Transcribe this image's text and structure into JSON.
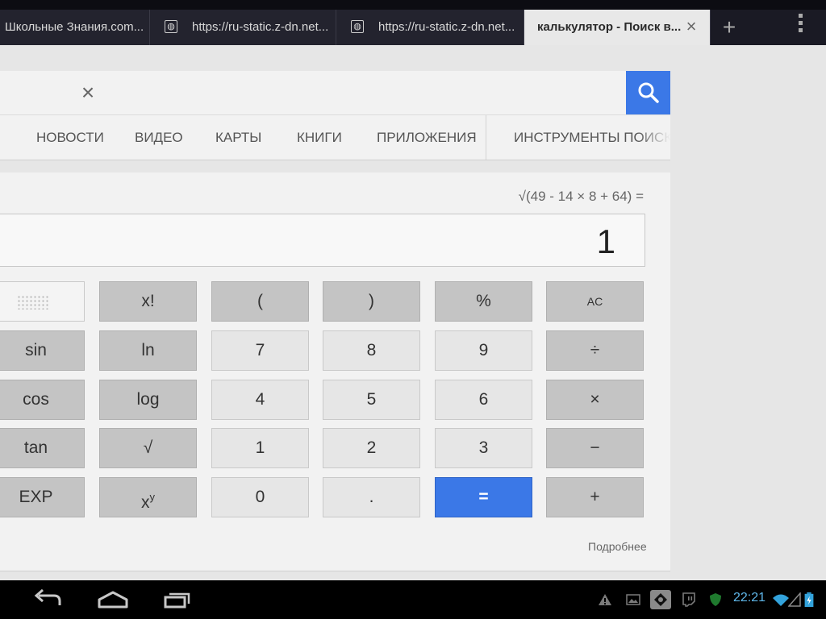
{
  "tabs": [
    {
      "label": "Школьные Знания.com..."
    },
    {
      "label": "https://ru-static.z-dn.net..."
    },
    {
      "label": "https://ru-static.z-dn.net..."
    },
    {
      "label": "калькулятор - Поиск в..."
    }
  ],
  "tab_icons": {
    "close": "×",
    "new_tab": "+"
  },
  "search": {
    "clear_icon": "×"
  },
  "nav": {
    "items": [
      "НОВОСТИ",
      "ВИДЕО",
      "КАРТЫ",
      "КНИГИ",
      "ПРИЛОЖЕНИЯ"
    ],
    "tools": "ИНСТРУМЕНТЫ ПОИСКА"
  },
  "calculator": {
    "expression": "√(49 - 14 × 8 + 64) =",
    "display": "1",
    "buttons": {
      "fact": "x!",
      "lparen": "(",
      "rparen": ")",
      "percent": "%",
      "ac": "AC",
      "sin": "sin",
      "ln": "ln",
      "n7": "7",
      "n8": "8",
      "n9": "9",
      "div": "÷",
      "cos": "cos",
      "log": "log",
      "n4": "4",
      "n5": "5",
      "n6": "6",
      "mul": "×",
      "tan": "tan",
      "sqrt": "√",
      "n1": "1",
      "n2": "2",
      "n3": "3",
      "sub": "−",
      "exp": "EXP",
      "pow_base": "x",
      "pow_sup": "y",
      "n0": "0",
      "dot": ".",
      "eq": "=",
      "add": "+"
    },
    "more": "Подробнее"
  },
  "statusbar": {
    "time": "22:21"
  },
  "colors": {
    "accent": "#3b78e7",
    "clock": "#5fb7ea"
  }
}
